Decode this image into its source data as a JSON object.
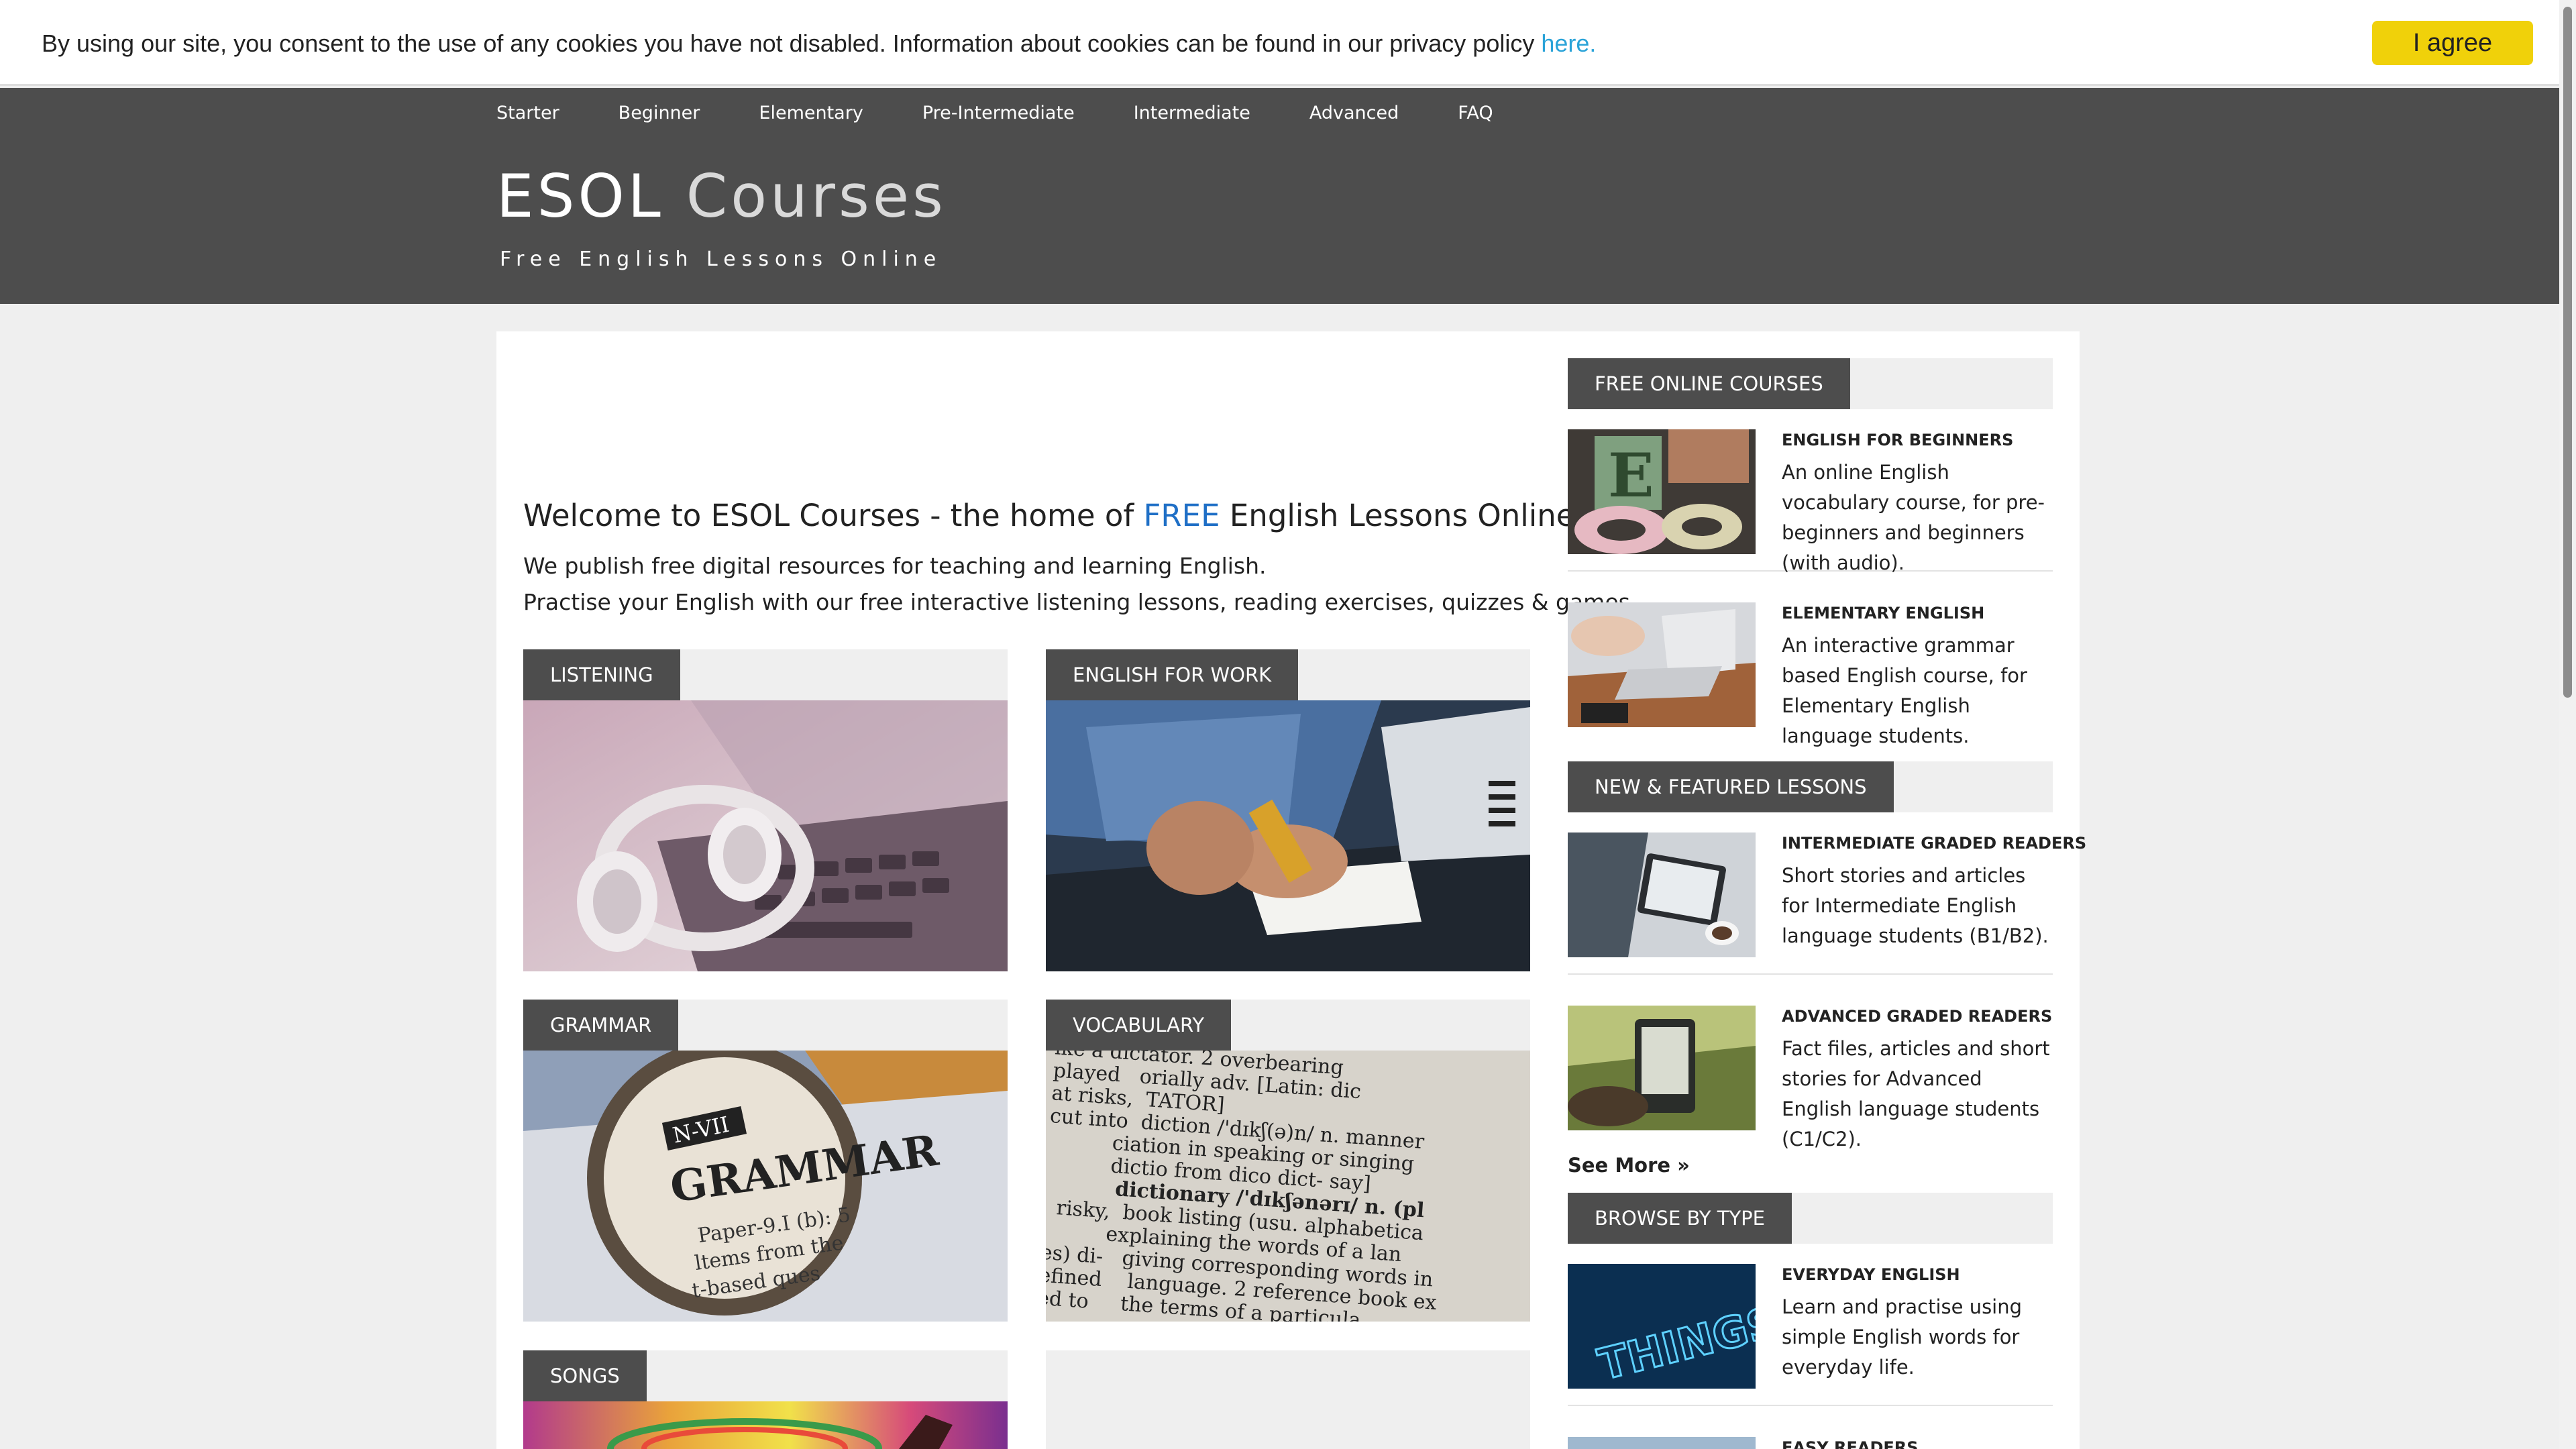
{
  "cookie": {
    "text": "By using our site, you consent to the use of any cookies you have not disabled. Information about cookies can be found in our privacy policy ",
    "link": "here.",
    "button": "I agree"
  },
  "nav": [
    "Starter",
    "Beginner",
    "Elementary",
    "Pre-Intermediate",
    "Intermediate",
    "Advanced",
    "FAQ"
  ],
  "header": {
    "title_a": "ESOL",
    "title_b": "Courses",
    "tagline": "Free English Lessons Online"
  },
  "main": {
    "welcome_a": "Welcome to ESOL Courses - the home of ",
    "welcome_free": "FREE",
    "welcome_b": " English Lessons Online",
    "intro1": "We publish free digital resources for teaching and learning English.",
    "intro2": "Practise your English with our free interactive listening lessons, reading exercises, quizzes & games.",
    "cards": [
      "LISTENING",
      "ENGLISH FOR WORK",
      "GRAMMAR",
      "VOCABULARY",
      "SONGS"
    ]
  },
  "sidebar": {
    "section1": "FREE ONLINE COURSES",
    "section2": "NEW & FEATURED LESSONS",
    "section3": "BROWSE BY TYPE",
    "items": [
      {
        "title": "ENGLISH FOR BEGINNERS",
        "desc": "An online English vocabulary course, for pre-beginners and beginners (with audio)."
      },
      {
        "title": "ELEMENTARY ENGLISH",
        "desc": "An interactive grammar based English course, for Elementary English language students."
      },
      {
        "title": "INTERMEDIATE GRADED READERS",
        "desc": "Short stories and articles for Intermediate English language students (B1/B2)."
      },
      {
        "title": "ADVANCED GRADED READERS",
        "desc": "Fact files, articles and short stories for Advanced English language students (C1/C2)."
      },
      {
        "title": "EVERYDAY ENGLISH",
        "desc": "Learn and practise using simple English words for everyday life."
      },
      {
        "title": "EASY READERS",
        "desc": ""
      }
    ],
    "see_more": "See More »"
  },
  "images": {
    "grammar_text": "GRAMMAR",
    "grammar_sub": "N-VII",
    "grammar_line1": "Paper-9.I (b): 5",
    "grammar_line2": "ltems from the",
    "grammar_line3": "t-based ques",
    "dict_lines": [
      "ike a dictator. 2 overbearing",
      "played   orially adv. [Latin: dic",
      "at risks,  TATOR]",
      "cut into  diction /'dɪkʃ(ə)n/ n. manner",
      "          ciation in speaking or singing",
      "          dictio from dico dict- say]",
      "          dictionary /'dɪkʃənərɪ/ n. (pl",
      "  risky,  book listing (usu. alphabetica",
      "          explaining the words of a lan",
      "es) di-   giving corresponding words in",
      "efined    language. 2 reference book ex",
      "ed to     the terms of a particula"
    ],
    "neon_text": "THINGS"
  }
}
